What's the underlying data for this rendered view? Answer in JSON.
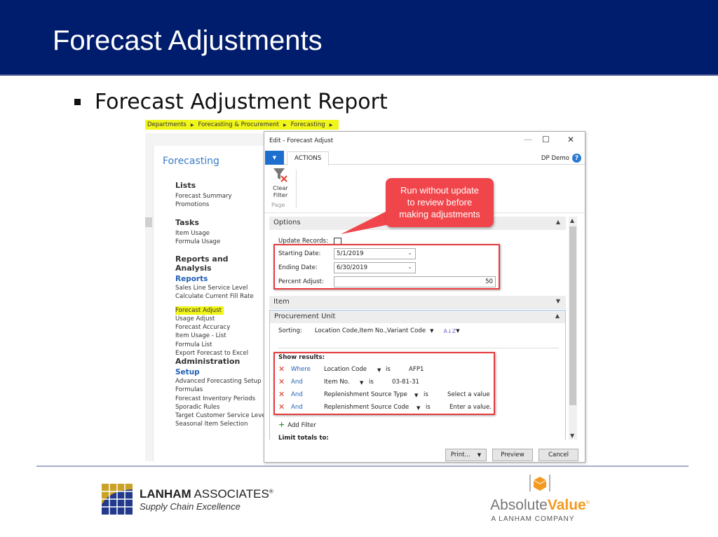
{
  "slide": {
    "title": "Forecast Adjustments",
    "bullet": "Forecast Adjustment Report"
  },
  "breadcrumb": [
    "Departments",
    "Forecasting & Procurement",
    "Forecasting"
  ],
  "nav": {
    "title": "Forecasting",
    "lists": {
      "heading": "Lists",
      "items": [
        "Forecast Summary",
        "Promotions"
      ]
    },
    "tasks": {
      "heading": "Tasks",
      "items": [
        "Item Usage",
        "Formula Usage"
      ]
    },
    "reports": {
      "heading": "Reports and Analysis",
      "subheading": "Reports",
      "items": [
        "Sales Line Service Level",
        "Calculate Current Fill Rate",
        "Forecast Adjust",
        "Usage Adjust",
        "Forecast Accuracy",
        "Item Usage - List",
        "Formula List",
        "Export Forecast to Excel"
      ],
      "highlighted": "Forecast Adjust"
    },
    "admin": {
      "heading": "Administration",
      "subheading": "Setup",
      "items": [
        "Advanced Forecasting Setup",
        "Formulas",
        "Forecast Inventory Periods",
        "Sporadic Rules",
        "Target Customer Service Level",
        "Seasonal Item Selection"
      ]
    }
  },
  "dialog": {
    "caption": "Edit - Forecast Adjust",
    "window_buttons": {
      "minimize": "—",
      "maximize": "☐",
      "close": "✕"
    },
    "tab": "ACTIONS",
    "user": "DP Demo",
    "help": "?",
    "ribbon": {
      "clear_filter": [
        "Clear",
        "Filter"
      ],
      "group": "Page"
    },
    "options": {
      "header": "Options",
      "update_records": {
        "label": "Update Records:",
        "checked": false
      },
      "starting_date": {
        "label": "Starting Date:",
        "value": "5/1/2019"
      },
      "ending_date": {
        "label": "Ending Date:",
        "value": "6/30/2019"
      },
      "percent_adjust": {
        "label": "Percent Adjust:",
        "value": "50"
      }
    },
    "item_header": "Item",
    "procurement": {
      "header": "Procurement Unit",
      "sorting_label": "Sorting:",
      "sorting_value": "Location Code,Item No.,Variant Code",
      "show_results": "Show results:",
      "filters": [
        {
          "conj": "Where",
          "field": "Location Code",
          "op": "is",
          "value": "AFP1"
        },
        {
          "conj": "And",
          "field": "Item No.",
          "op": "is",
          "value": "03-81-31"
        },
        {
          "conj": "And",
          "field": "Replenishment Source Type",
          "op": "is",
          "value": "Select a value"
        },
        {
          "conj": "And",
          "field": "Replenishment Source Code",
          "op": "is",
          "value": "Enter a value."
        }
      ],
      "add_filter": "Add Filter",
      "limit_totals": "Limit totals to:"
    },
    "buttons": {
      "print": "Print...",
      "preview": "Preview",
      "cancel": "Cancel"
    }
  },
  "callout": {
    "lines": [
      "Run without update",
      "to review before",
      "making adjustments"
    ],
    "color": "#f0454a"
  },
  "footer": {
    "lanham": {
      "name_bold": "LANHAM",
      "name_rest": " ASSOCIATES",
      "reg": "®",
      "tagline": "Supply Chain Excellence"
    },
    "absolute_value": {
      "word1": "Absolute",
      "word2": "Value",
      "reg": "®",
      "sub": "A LANHAM COMPANY"
    }
  },
  "colors": {
    "title_bg": "#001c6c",
    "highlight": "#f0f51a",
    "accent_blue": "#1c6fcf",
    "annotation_red": "#e5393c",
    "av_orange": "#f39a21"
  }
}
